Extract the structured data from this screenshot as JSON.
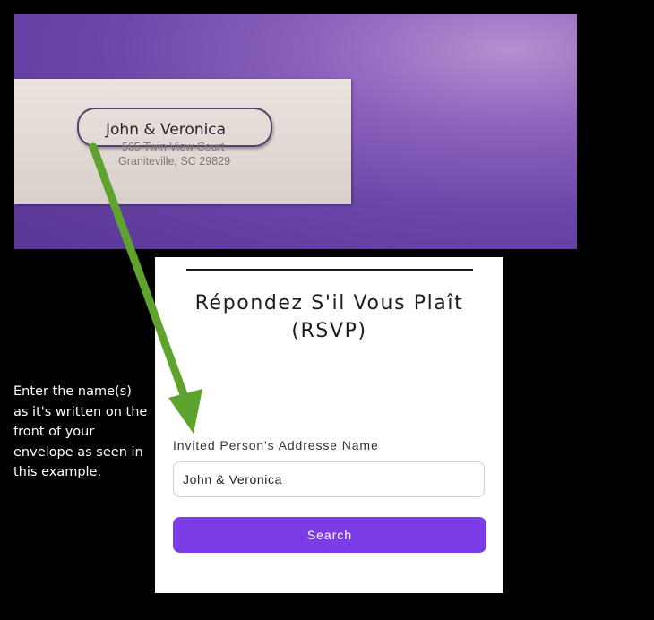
{
  "envelope": {
    "recipient_name": "John & Veronica",
    "street": "565 Twin View Court",
    "city_line": "Graniteville, SC 29829"
  },
  "instructions": {
    "text": "Enter the name(s) as it's written on the front of your envelope as seen in this example."
  },
  "rsvp_form": {
    "title": "Répondez S'il Vous Plaît (RSVP)",
    "field_label": "Invited Person's Addresse Name",
    "name_value": "John & Veronica",
    "search_label": "Search"
  },
  "colors": {
    "envelope_purple": "#6a44a6",
    "arrow_green": "#5fa32f",
    "button_purple": "#7c3ce6"
  }
}
